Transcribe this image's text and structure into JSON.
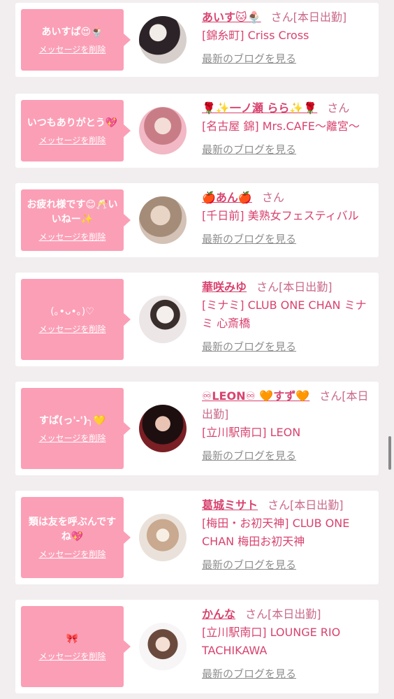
{
  "delete_label": "メッセージを削除",
  "blog_label": "最新のブログを見る",
  "san_label": "さん",
  "items": [
    {
      "message": "あいすぱ😍🍨",
      "name": "あいす🐱🍨",
      "status": "[本日出勤]",
      "shop": "[錦糸町] Criss Cross",
      "avatar": "photo-dark-hair-peace-sign"
    },
    {
      "message": "いつもありがとう💖",
      "name": "🌹✨一ノ瀬 らら✨🌹",
      "status": "",
      "shop": "[名古屋 錦] Mrs.CAFE〜離宮〜",
      "avatar": "photo-pink-room"
    },
    {
      "message": "お疲れ様です😊🥂いいねー✨",
      "name": "🍎あん🍎",
      "status": "",
      "shop": "[千日前] 美熟女フェスティバル",
      "avatar": "photo-blurred-face"
    },
    {
      "message": "(｡•ᴗ•｡)♡",
      "name": "華咲みゆ",
      "status": "[本日出勤]",
      "shop": "[ミナミ] CLUB ONE CHAN ミナミ 心斎橋",
      "avatar": "photo-white-dress"
    },
    {
      "message": "すぱ(っ'-')╮💛",
      "name": "♾LEON♾ 🧡すず🧡",
      "status": "[本日出勤]",
      "shop": "[立川駅南口] LEON",
      "avatar": "photo-dark-background"
    },
    {
      "message": "類は友を呼ぶんですね💖",
      "name": "葛城ミサト",
      "status": "[本日出勤]",
      "shop": "[梅田・お初天神] CLUB ONE CHAN 梅田お初天神",
      "avatar": "photo-flower-face"
    },
    {
      "message": "🎀",
      "name": "かんな",
      "status": "[本日出勤]",
      "shop": "[立川駅南口] LOUNGE RIO TACHIKAWA",
      "avatar": "photo-white-background"
    }
  ]
}
